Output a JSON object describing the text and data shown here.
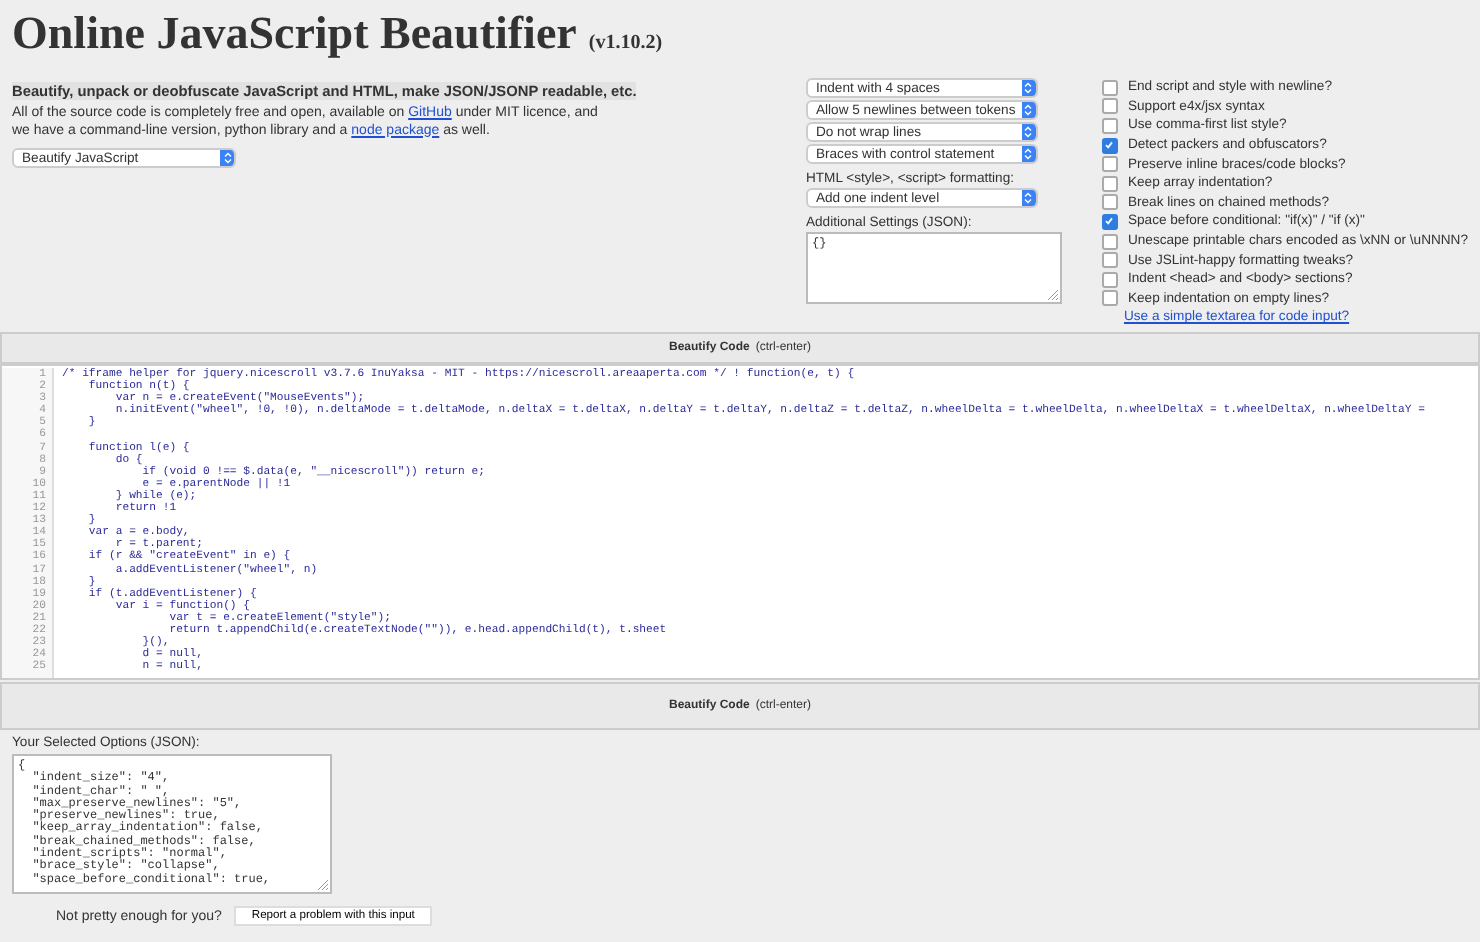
{
  "header": {
    "title": "Online JavaScript Beautifier",
    "version": "(v1.10.2)",
    "tagline": "Beautify, unpack or deobfuscate JavaScript and HTML, make JSON/JSONP readable, etc.",
    "intro": [
      {
        "kind": "text",
        "text": "All of the source code is completely free and open, available on "
      },
      {
        "kind": "link",
        "text": "GitHub"
      },
      {
        "kind": "text",
        "text": " under MIT licence, and we have a command-line version, python library and a "
      },
      {
        "kind": "link",
        "text": "node package"
      },
      {
        "kind": "text",
        "text": " as well."
      }
    ],
    "mode_select": "Beautify JavaScript"
  },
  "settings": {
    "selects": [
      "Indent with 4 spaces",
      "Allow 5 newlines between tokens",
      "Do not wrap lines",
      "Braces with control statement"
    ],
    "html_label": "HTML <style>, <script> formatting:",
    "html_select": "Add one indent level",
    "additional_label": "Additional Settings (JSON):",
    "additional_value": "{}"
  },
  "checkboxes": [
    {
      "label": "End script and style with newline?",
      "checked": false
    },
    {
      "label": "Support e4x/jsx syntax",
      "checked": false
    },
    {
      "label": "Use comma-first list style?",
      "checked": false
    },
    {
      "label": "Detect packers and obfuscators?",
      "checked": true
    },
    {
      "label": "Preserve inline braces/code blocks?",
      "checked": false
    },
    {
      "label": "Keep array indentation?",
      "checked": false
    },
    {
      "label": "Break lines on chained methods?",
      "checked": false
    },
    {
      "label": "Space before conditional: \"if(x)\" / \"if (x)\"",
      "checked": true
    },
    {
      "label": "Unescape printable chars encoded as \\xNN or \\uNNNN?",
      "checked": false
    },
    {
      "label": "Use JSLint-happy formatting tweaks?",
      "checked": false
    },
    {
      "label": "Indent <head> and <body> sections?",
      "checked": false
    },
    {
      "label": "Keep indentation on empty lines?",
      "checked": false
    }
  ],
  "textarea_link": "Use a simple textarea for code input?",
  "beautify_button": {
    "label": "Beautify Code",
    "shortcut": "(ctrl-enter)"
  },
  "code": {
    "lines": [
      {
        "number": "1",
        "text": "/* iframe helper for jquery.nicescroll v3.7.6 InuYaksa - MIT - https://nicescroll.areaaperta.com */ ! function(e, t) {"
      },
      {
        "number": "2",
        "text": "    function n(t) {"
      },
      {
        "number": "3",
        "text": "        var n = e.createEvent(\"MouseEvents\");"
      },
      {
        "number": "4",
        "text": "        n.initEvent(\"wheel\", !0, !0), n.deltaMode = t.deltaMode, n.deltaX = t.deltaX, n.deltaY = t.deltaY, n.deltaZ = t.deltaZ, n.wheelDelta = t.wheelDelta, n.wheelDeltaX = t.wheelDeltaX, n.wheelDeltaY ="
      },
      {
        "number": "5",
        "text": "    }"
      },
      {
        "number": "6"
      },
      {
        "number": "7",
        "text": "    function l(e) {"
      },
      {
        "number": "8",
        "text": "        do {"
      },
      {
        "number": "9",
        "text": "            if (void 0 !== $.data(e, \"__nicescroll\")) return e;"
      },
      {
        "number": "10",
        "text": "            e = e.parentNode || !1"
      },
      {
        "number": "11",
        "text": "        } while (e);"
      },
      {
        "number": "12",
        "text": "        return !1"
      },
      {
        "number": "13",
        "text": "    }"
      },
      {
        "number": "14",
        "text": "    var a = e.body,"
      },
      {
        "number": "15",
        "text": "        r = t.parent;"
      },
      {
        "number": "16",
        "text": "    if (r && \"createEvent\" in e) {"
      },
      {
        "number": "17",
        "text": "        a.addEventListener(\"wheel\", n)"
      },
      {
        "number": "18",
        "text": "    }"
      },
      {
        "number": "19",
        "text": "    if (t.addEventListener) {"
      },
      {
        "number": "20",
        "text": "        var i = function() {"
      },
      {
        "number": "21",
        "text": "                var t = e.createElement(\"style\");"
      },
      {
        "number": "22",
        "text": "                return t.appendChild(e.createTextNode(\"\")), e.head.appendChild(t), t.sheet"
      },
      {
        "number": "23",
        "text": "            }(),"
      },
      {
        "number": "24",
        "text": "            d = null,"
      },
      {
        "number": "25",
        "text": "            n = null,"
      }
    ]
  },
  "beautify_button_2": {
    "label": "Beautify Code",
    "shortcut": "(ctrl-enter)"
  },
  "options": {
    "label": "Your Selected Options (JSON):",
    "lines": [
      "{",
      "  \"indent_size\": \"4\",",
      "  \"indent_char\": \" \",",
      "  \"max_preserve_newlines\": \"5\",",
      "  \"preserve_newlines\": true,",
      "  \"keep_array_indentation\": false,",
      "  \"break_chained_methods\": false,",
      "  \"indent_scripts\": \"normal\",",
      "  \"brace_style\": \"collapse\",",
      "  \"space_before_conditional\": true,"
    ]
  },
  "footer": {
    "text": "Not pretty enough for you?",
    "button": "Report a problem with this input"
  }
}
